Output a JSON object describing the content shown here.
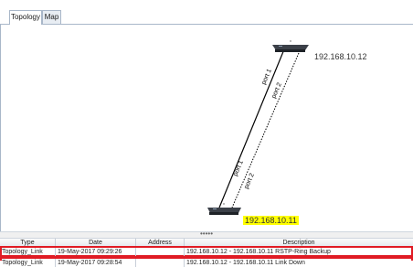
{
  "tabs": [
    {
      "label": "Topology",
      "active": true
    },
    {
      "label": "Map",
      "active": false
    }
  ],
  "devices": [
    {
      "ip": "192.168.10.12"
    },
    {
      "ip": "192.168.10.11",
      "highlighted": true
    }
  ],
  "links": [
    {
      "style": "solid",
      "from_port": "port 1",
      "to_port": "port 1"
    },
    {
      "style": "dotted",
      "from_port": "port 2",
      "to_port": "port 2"
    }
  ],
  "splitter_handle": "•••••",
  "event_table": {
    "columns": [
      "Type",
      "Date",
      "Address",
      "Description"
    ],
    "rows": [
      {
        "type": "Topology_Link",
        "date": "19-May-2017 09:29:26",
        "address": "",
        "description": "192.168.10.12 - 192.168.10.11 RSTP-Ring Backup"
      },
      {
        "type": "Topology_Link",
        "date": "19-May-2017 09:28:54",
        "address": "",
        "description": "192.168.10.12 - 192.168.10.11 Link Down"
      }
    ]
  },
  "colors": {
    "highlight": "#ffff00",
    "row_marker": "#e01b24",
    "tab_border": "#a9b7c9"
  }
}
